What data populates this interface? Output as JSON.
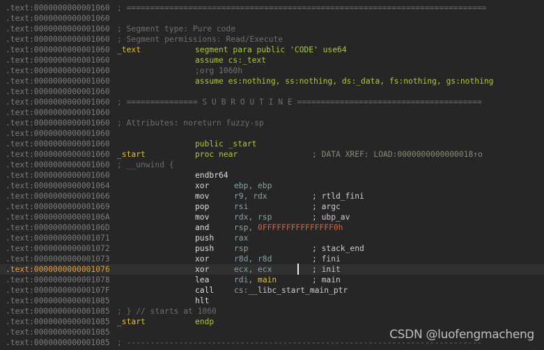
{
  "colors": {
    "background": "#262626",
    "address": "#7c7c7c",
    "current_address": "#e8a23a",
    "directive": "#a8cc34",
    "label": "#e6c02a",
    "register": "#86a4a8",
    "number": "#e0603c",
    "comment": "#6e6e6e"
  },
  "rows": [
    {
      "addr": ".text:0000000000001060",
      "cmt0": "; ============================================================================"
    },
    {
      "addr": ".text:0000000000001060"
    },
    {
      "addr": ".text:0000000000001060",
      "cmt0": "; Segment type: Pure code"
    },
    {
      "addr": ".text:0000000000001060",
      "cmt0": "; Segment permissions: Read/Execute"
    },
    {
      "addr": ".text:0000000000001060",
      "label": "_text",
      "dir": "segment para public 'CODE' use64"
    },
    {
      "addr": ".text:0000000000001060",
      "dir": "assume cs:_text"
    },
    {
      "addr": ".text:0000000000001060",
      "dircmt": ";org 1060h"
    },
    {
      "addr": ".text:0000000000001060",
      "dir": "assume es:nothing, ss:nothing, ds:_data, fs:nothing, gs:nothing"
    },
    {
      "addr": ".text:0000000000001060"
    },
    {
      "addr": ".text:0000000000001060",
      "cmt0": "; =============== S U B R O U T I N E ======================================="
    },
    {
      "addr": ".text:0000000000001060"
    },
    {
      "addr": ".text:0000000000001060",
      "cmt0": "; Attributes: noreturn fuzzy-sp"
    },
    {
      "addr": ".text:0000000000001060"
    },
    {
      "addr": ".text:0000000000001060",
      "dir": "public _start"
    },
    {
      "addr": ".text:0000000000001060",
      "label": "_start",
      "dir": "proc near",
      "xref": "; DATA XREF: LOAD:0000000000000018↑o"
    },
    {
      "addr": ".text:0000000000001060",
      "cmt0": "; __unwind {"
    },
    {
      "addr": ".text:0000000000001060",
      "mnem": "endbr64"
    },
    {
      "addr": ".text:0000000000001064",
      "mnem": "xor",
      "ops": [
        {
          "t": "reg",
          "v": "ebp, ebp"
        }
      ]
    },
    {
      "addr": ".text:0000000000001066",
      "mnem": "mov",
      "ops": [
        {
          "t": "reg",
          "v": "r9, rdx"
        }
      ],
      "cmt": "; rtld_fini"
    },
    {
      "addr": ".text:0000000000001069",
      "mnem": "pop",
      "ops": [
        {
          "t": "reg",
          "v": "rsi"
        }
      ],
      "cmt": "; argc"
    },
    {
      "addr": ".text:000000000000106A",
      "mnem": "mov",
      "ops": [
        {
          "t": "reg",
          "v": "rdx, rsp"
        }
      ],
      "cmt": "; ubp_av"
    },
    {
      "addr": ".text:000000000000106D",
      "mnem": "and",
      "ops": [
        {
          "t": "reg",
          "v": "rsp, "
        },
        {
          "t": "num",
          "v": "0FFFFFFFFFFFFFFF0h"
        }
      ]
    },
    {
      "addr": ".text:0000000000001071",
      "mnem": "push",
      "ops": [
        {
          "t": "reg",
          "v": "rax"
        }
      ]
    },
    {
      "addr": ".text:0000000000001072",
      "mnem": "push",
      "ops": [
        {
          "t": "reg",
          "v": "rsp"
        }
      ],
      "cmt": "; stack_end"
    },
    {
      "addr": ".text:0000000000001073",
      "mnem": "xor",
      "ops": [
        {
          "t": "reg",
          "v": "r8d, r8d"
        }
      ],
      "cmt": "; fini"
    },
    {
      "addr": ".text:0000000000001076",
      "mnem": "xor",
      "ops": [
        {
          "t": "reg",
          "v": "ecx, ecx"
        }
      ],
      "cmt": "; init",
      "current": true
    },
    {
      "addr": ".text:0000000000001078",
      "mnem": "lea",
      "ops": [
        {
          "t": "reg",
          "v": "rdi, "
        },
        {
          "t": "name",
          "v": "main"
        }
      ],
      "cmt": "; main"
    },
    {
      "addr": ".text:000000000000107F",
      "mnem": "call",
      "ops": [
        {
          "t": "reg",
          "v": "cs:"
        },
        {
          "t": "sym",
          "v": "__libc_start_main_ptr"
        }
      ]
    },
    {
      "addr": ".text:0000000000001085",
      "mnem": "hlt"
    },
    {
      "addr": ".text:0000000000001085",
      "cmt0": "; } // starts at 1060"
    },
    {
      "addr": ".text:0000000000001085",
      "label": "_start",
      "dir": "endp"
    },
    {
      "addr": ".text:0000000000001085"
    },
    {
      "addr": ".text:0000000000001085",
      "cmt0": "; ---------------------------------------------------------------------------"
    }
  ],
  "watermark": "CSDN @luofengmacheng"
}
